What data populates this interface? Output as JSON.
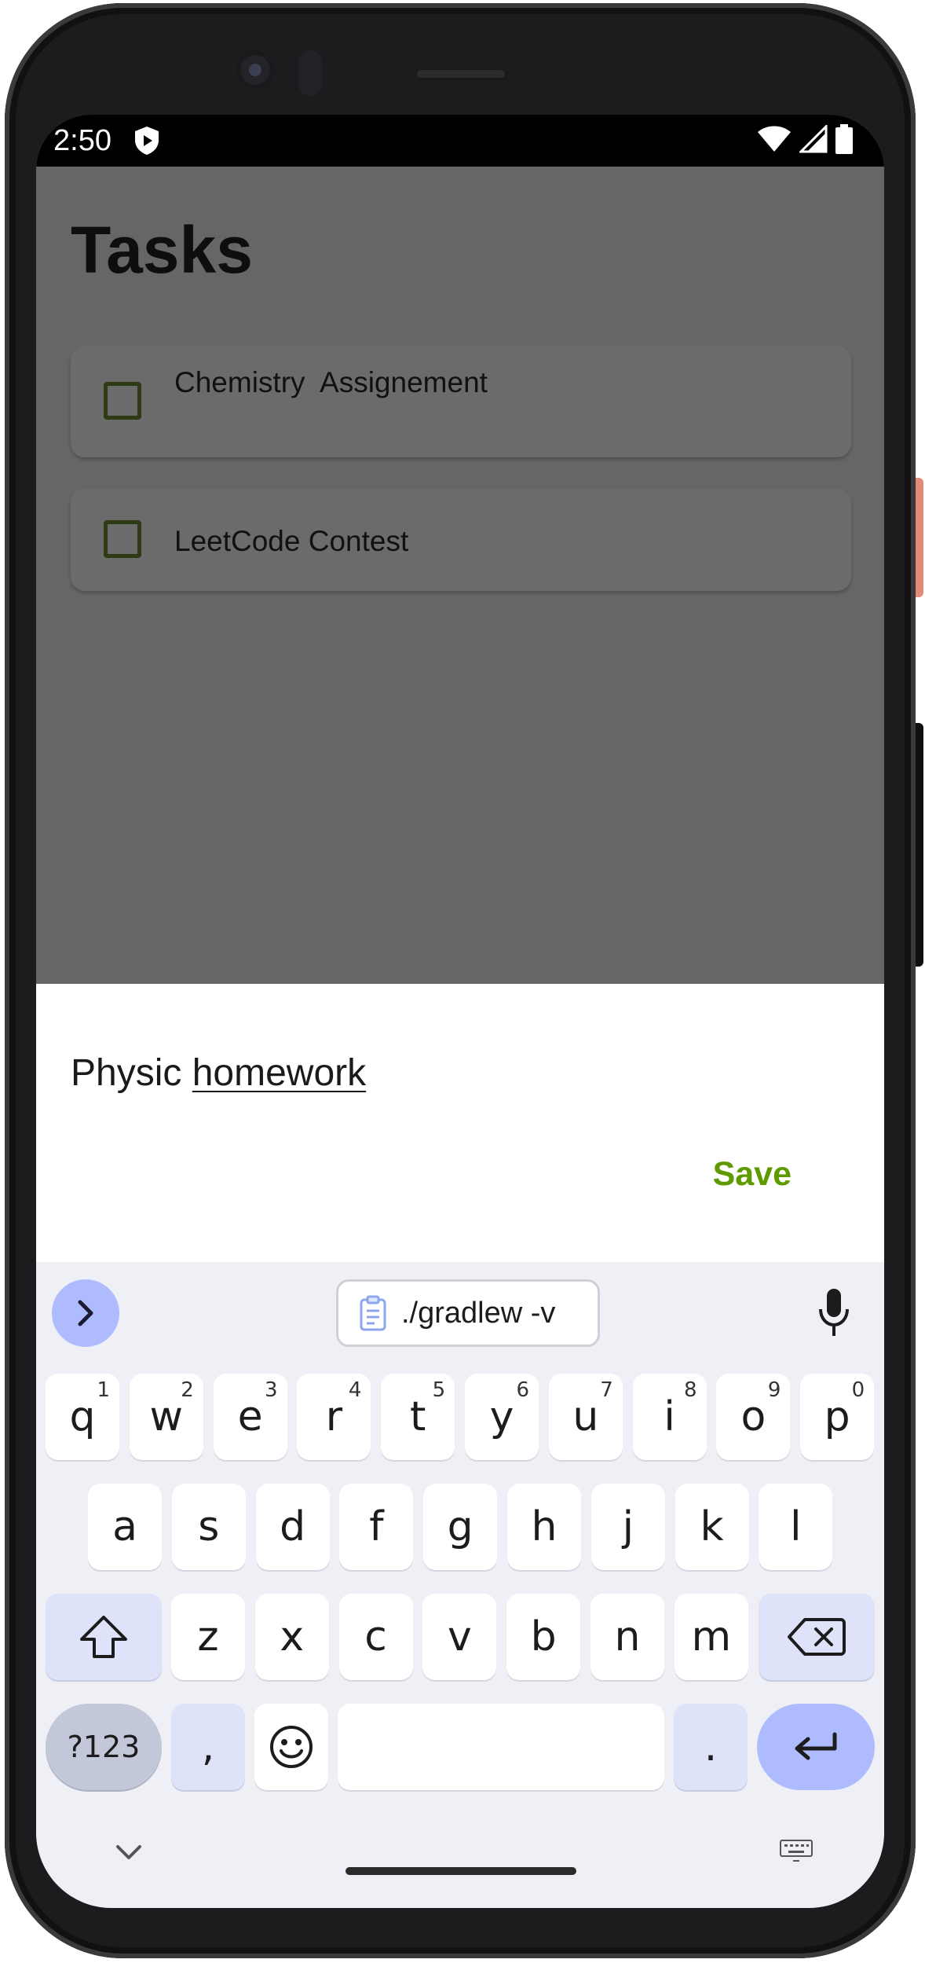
{
  "status_bar": {
    "time": "2:50",
    "icons": [
      "shield-icon",
      "wifi-icon",
      "signal-icon",
      "battery-icon"
    ]
  },
  "app": {
    "title": "Tasks",
    "tasks": [
      {
        "label": "Chemistry  Assignement",
        "checked": false
      },
      {
        "label": "LeetCode Contest",
        "checked": false
      }
    ]
  },
  "sheet": {
    "input_value_plain": "Physic ",
    "input_value_composing": "homework",
    "save_label": "Save"
  },
  "keyboard": {
    "clipboard_suggestion": "./gradlew -v",
    "row1": [
      {
        "k": "q",
        "n": "1"
      },
      {
        "k": "w",
        "n": "2"
      },
      {
        "k": "e",
        "n": "3"
      },
      {
        "k": "r",
        "n": "4"
      },
      {
        "k": "t",
        "n": "5"
      },
      {
        "k": "y",
        "n": "6"
      },
      {
        "k": "u",
        "n": "7"
      },
      {
        "k": "i",
        "n": "8"
      },
      {
        "k": "o",
        "n": "9"
      },
      {
        "k": "p",
        "n": "0"
      }
    ],
    "row2": [
      "a",
      "s",
      "d",
      "f",
      "g",
      "h",
      "j",
      "k",
      "l"
    ],
    "row3": [
      "z",
      "x",
      "c",
      "v",
      "b",
      "n",
      "m"
    ],
    "symbols_label": "?123",
    "comma_label": ",",
    "period_label": "."
  },
  "colors": {
    "accent_save": "#5f9a00",
    "scrim": "#666666",
    "keyboard_bg": "#efeff6",
    "key_enter": "#aebcff"
  }
}
